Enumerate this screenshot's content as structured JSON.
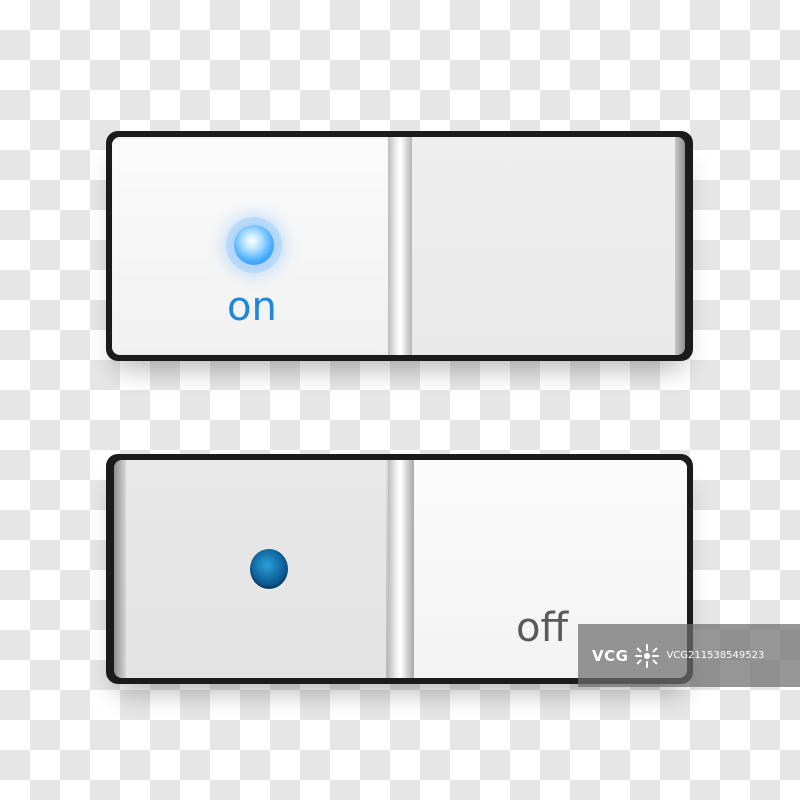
{
  "switches": {
    "top": {
      "state": "on",
      "label": "on",
      "indicator": "lit",
      "indicator_color": "#3b9cff",
      "label_color": "#1e86e0"
    },
    "bottom": {
      "state": "off",
      "label": "off",
      "indicator": "unlit",
      "indicator_color": "#0d5f98",
      "label_color": "#5a5a5a"
    }
  },
  "watermark": {
    "logo": "VCG",
    "code": "VCG211538549523"
  },
  "icons": [
    "indicator-led-icon",
    "vcg-logo-icon"
  ]
}
